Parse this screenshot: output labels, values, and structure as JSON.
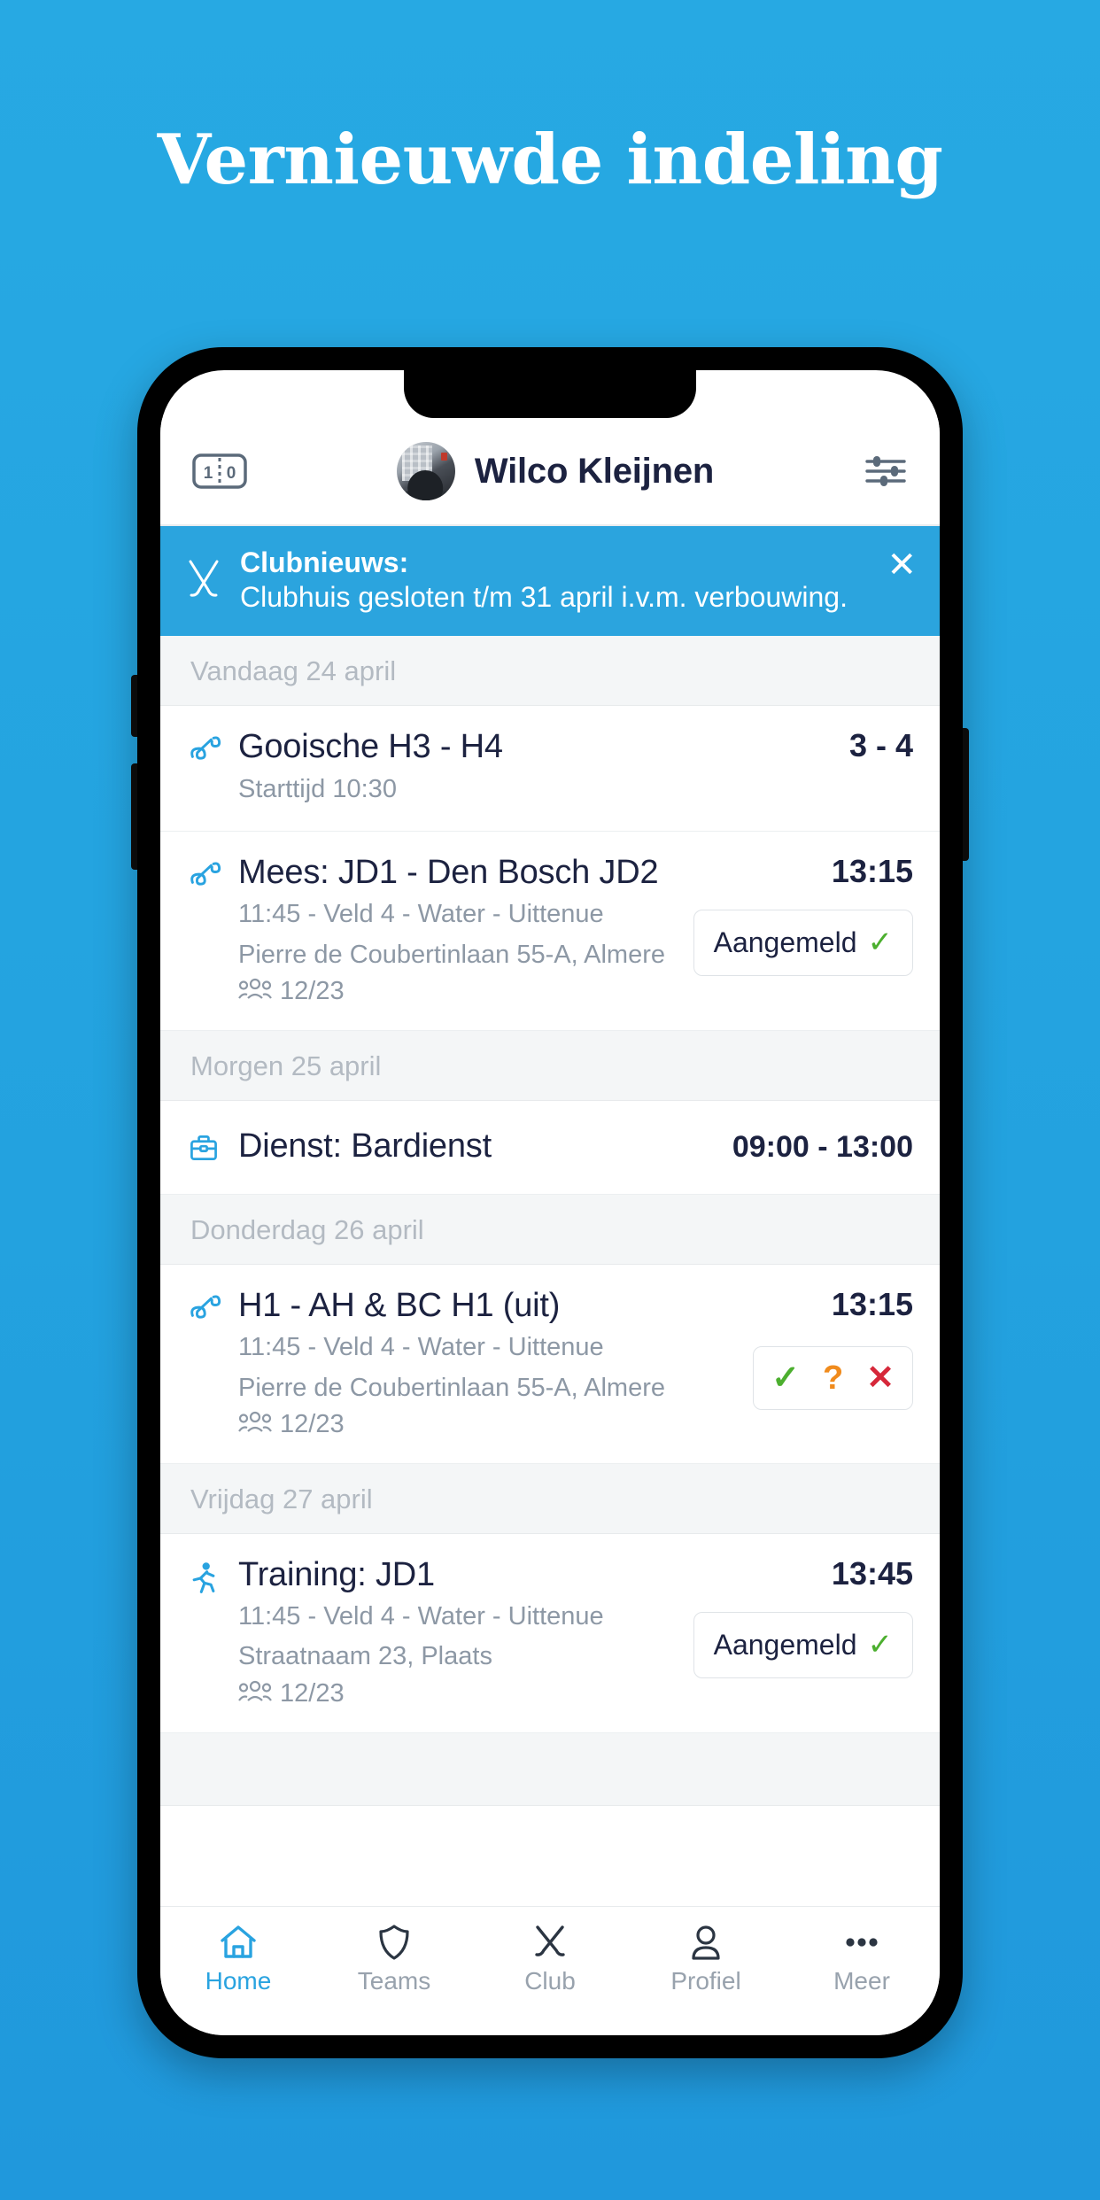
{
  "headline": "Vernieuwde indeling",
  "colors": {
    "background_top": "#27a9e3",
    "background_bottom": "#2098dc",
    "accent": "#29a3e0",
    "banner": "#2ba4de",
    "text_dark": "#1c2240",
    "text_muted": "#8d98a5",
    "green": "#4caf2f",
    "orange": "#f08b1d",
    "red": "#d6283a"
  },
  "app": {
    "header": {
      "score_icon": "scoreboard-icon",
      "score_home": "1",
      "score_away": "0",
      "user_name": "Wilco Kleijnen",
      "settings_icon": "sliders-icon"
    },
    "news_banner": {
      "icon": "hockey-sticks-icon",
      "title": "Clubnieuws:",
      "body": "Clubhuis gesloten t/m 31 april i.v.m. verbouwing.",
      "close_icon": "close-icon"
    },
    "sections": [
      {
        "date_label": "Vandaag 24 april",
        "items": [
          {
            "icon": "hockey-sticks-icon",
            "title": "Gooische H3 - H4",
            "sub1": "Starttijd 10:30",
            "sub2": "",
            "attendance": "",
            "right_value": "3 - 4",
            "action": "none"
          },
          {
            "icon": "hockey-sticks-icon",
            "title": "Mees: JD1 - Den Bosch JD2",
            "sub1": "11:45 - Veld 4 - Water - Uittenue",
            "sub2": "Pierre de Coubertinlaan 55-A, Almere",
            "attendance": "12/23",
            "right_value": "13:15",
            "action": "attend",
            "action_label": "Aangemeld"
          }
        ]
      },
      {
        "date_label": "Morgen 25 april",
        "items": [
          {
            "icon": "briefcase-icon",
            "title": "Dienst: Bardienst",
            "sub1": "",
            "sub2": "",
            "attendance": "",
            "right_value": "09:00 - 13:00",
            "action": "none"
          }
        ]
      },
      {
        "date_label": "Donderdag 26 april",
        "items": [
          {
            "icon": "hockey-sticks-icon",
            "title": "H1 - AH & BC H1 (uit)",
            "sub1": "11:45 - Veld 4 - Water - Uittenue",
            "sub2": "Pierre de Coubertinlaan 55-A, Almere",
            "attendance": "12/23",
            "right_value": "13:15",
            "action": "choices",
            "choice_yes": "✓",
            "choice_maybe": "?",
            "choice_no": "✕"
          }
        ]
      },
      {
        "date_label": "Vrijdag 27 april",
        "items": [
          {
            "icon": "runner-icon",
            "title": "Training: JD1",
            "sub1": "11:45 - Veld 4 - Water - Uittenue",
            "sub2": "Straatnaam 23, Plaats",
            "attendance": "12/23",
            "right_value": "13:45",
            "action": "attend",
            "action_label": "Aangemeld"
          }
        ]
      }
    ],
    "tabbar": [
      {
        "label": "Home",
        "icon": "home-icon",
        "active": true
      },
      {
        "label": "Teams",
        "icon": "shield-icon",
        "active": false
      },
      {
        "label": "Club",
        "icon": "hockey-sticks-icon",
        "active": false
      },
      {
        "label": "Profiel",
        "icon": "person-icon",
        "active": false
      },
      {
        "label": "Meer",
        "icon": "ellipsis-icon",
        "active": false
      }
    ]
  }
}
